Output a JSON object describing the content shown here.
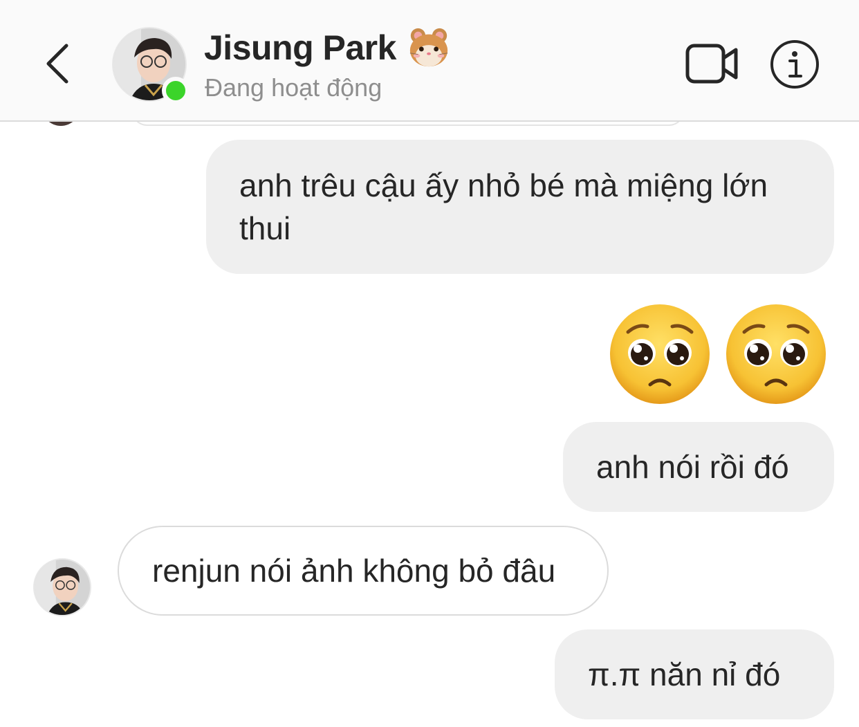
{
  "header": {
    "contact_name": "Jisung Park",
    "status": "Đang hoạt động",
    "name_emoji": "hamster-icon",
    "online_color": "#3bd42a"
  },
  "icons": {
    "back": "chevron-left-icon",
    "video_call": "video-camera-icon",
    "info": "info-circle-icon"
  },
  "messages": [
    {
      "type": "sent",
      "text": "anh trêu cậu ấy nhỏ bé mà miệng lớn thui"
    },
    {
      "type": "sent-emoji",
      "emoji": [
        "pleading-face-icon",
        "pleading-face-icon"
      ]
    },
    {
      "type": "sent",
      "text": "anh nói rồi đó"
    },
    {
      "type": "received",
      "text": "renjun nói ảnh không bỏ đâu"
    },
    {
      "type": "sent",
      "text": "π.π năn nỉ đó"
    }
  ],
  "colors": {
    "sent_bubble": "#efefef",
    "received_border": "#dbdbdb",
    "header_bg": "#fafafa",
    "secondary_text": "#8e8e8e"
  }
}
